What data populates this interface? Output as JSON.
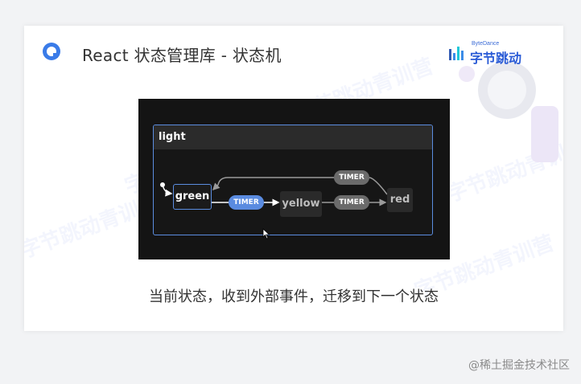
{
  "slide": {
    "title": "React 状态管理库 - 状态机",
    "brand": {
      "en": "ByteDance",
      "cn": "字节跳动"
    },
    "caption": "当前状态，收到外部事件，迁移到下一个状态",
    "watermark": "字节跳动青训营"
  },
  "statechart": {
    "machine": "light",
    "states": {
      "green": "green",
      "yellow": "yellow",
      "red": "red"
    },
    "events": {
      "green_to_yellow": "TIMER",
      "yellow_to_red": "TIMER",
      "red_to_green": "TIMER"
    }
  },
  "footer": {
    "credit": "@稀土掘金技术社区"
  },
  "colors": {
    "accent": "#5a8be0",
    "brand": "#2a5bd6",
    "panel": "#141414"
  }
}
